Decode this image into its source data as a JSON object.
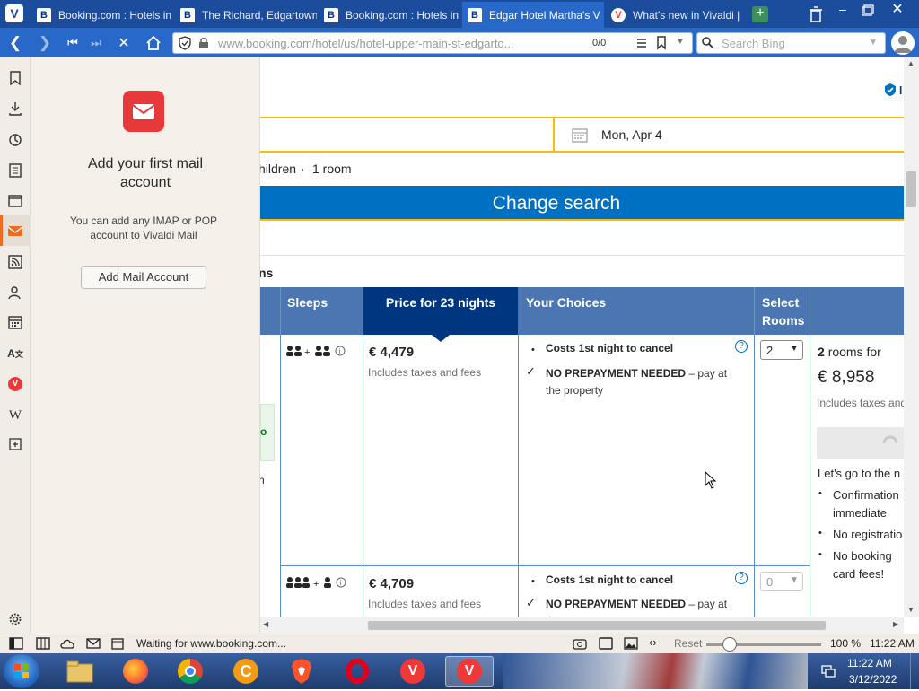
{
  "tabs": [
    {
      "title": "Booking.com : Hotels in",
      "favicon": "B",
      "type": "booking"
    },
    {
      "title": "The Richard, Edgartown",
      "favicon": "B",
      "type": "booking"
    },
    {
      "title": "Booking.com : Hotels in",
      "favicon": "B",
      "type": "booking"
    },
    {
      "title": "Edgar Hotel Martha's V",
      "favicon": "B",
      "type": "booking",
      "active": true
    },
    {
      "title": "What's new in Vivaldi |",
      "favicon": "V",
      "type": "vivaldi"
    }
  ],
  "address": {
    "url": "www.booking.com/hotel/us/hotel-upper-main-st-edgarto...",
    "find_count": "0/0",
    "search_placeholder": "Search Bing"
  },
  "mail_panel": {
    "heading": "Add your first mail account",
    "description": "You can add any IMAP or POP account to Vivaldi Mail",
    "button_label": "Add Mail Account"
  },
  "booking": {
    "checkout_date": "Mon, Apr 4",
    "occupancy_fragment": "hildren",
    "rooms_text": "1 room",
    "change_search_label": "Change search",
    "section_fragment": "ns",
    "table_headers": {
      "sleeps": "Sleeps",
      "price": "Price for 23 nights",
      "choices": "Your Choices",
      "select_rooms_line1": "Select",
      "select_rooms_line2": "Rooms"
    },
    "rows": [
      {
        "price": "€ 4,479",
        "price_note": "Includes taxes and fees",
        "cancel": "Costs 1st night to cancel",
        "prepay_bold": "NO PREPAYMENT NEEDED",
        "prepay_rest": " – pay at the property",
        "select_value": "2"
      },
      {
        "price": "€ 4,709",
        "price_note": "Includes taxes and fees",
        "cancel": "Costs 1st night to cancel",
        "prepay_bold": "NO PREPAYMENT NEEDED",
        "prepay_rest": " – pay at the",
        "select_value": "0"
      }
    ],
    "summary": {
      "rooms_count": "2",
      "rooms_label": "rooms for",
      "total": "€ 8,958",
      "total_note": "Includes taxes and",
      "lets_go": "Let's go to the n",
      "bullets": [
        "Confirmation",
        "immediate",
        "No registratio",
        "No booking",
        "card fees!"
      ]
    }
  },
  "statusbar": {
    "status_text": "Waiting for www.booking.com...",
    "reset_label": "Reset",
    "zoom": "100 %",
    "time": "11:22 AM"
  },
  "taskbar": {
    "clock_time": "11:22 AM",
    "clock_date": "3/12/2022"
  },
  "colors": {
    "tab_bar": "#1b4d9c",
    "nav_bar": "#2868c8",
    "booking_blue": "#0071c2",
    "booking_dark": "#003580",
    "table_header": "#4c76b2",
    "accent_yellow": "#febb02"
  }
}
